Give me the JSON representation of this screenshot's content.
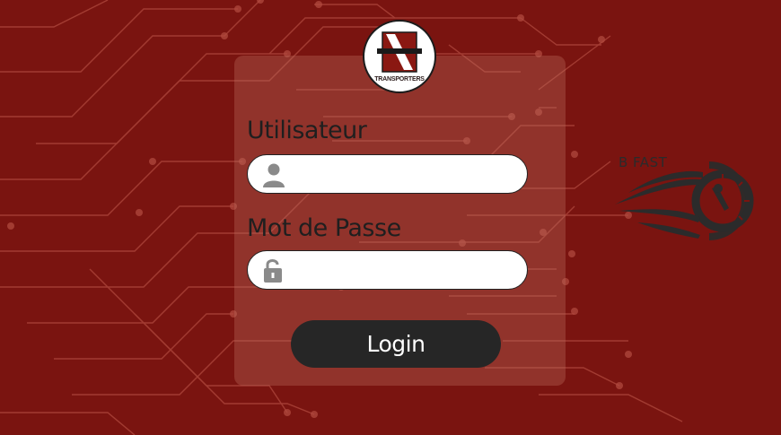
{
  "logo": {
    "text": "TRANSPORTERS"
  },
  "form": {
    "username_label": "Utilisateur",
    "username_value": "",
    "password_label": "Mot de Passe",
    "password_value": "",
    "login_label": "Login"
  },
  "brand": {
    "text": "B FAST"
  },
  "colors": {
    "background": "#7a1410",
    "panel": "#b26e5f",
    "button": "#262626",
    "circuit": "#b5473c"
  },
  "icons": {
    "username": "user-icon",
    "password": "unlock-icon",
    "brand": "speedometer-icon"
  }
}
